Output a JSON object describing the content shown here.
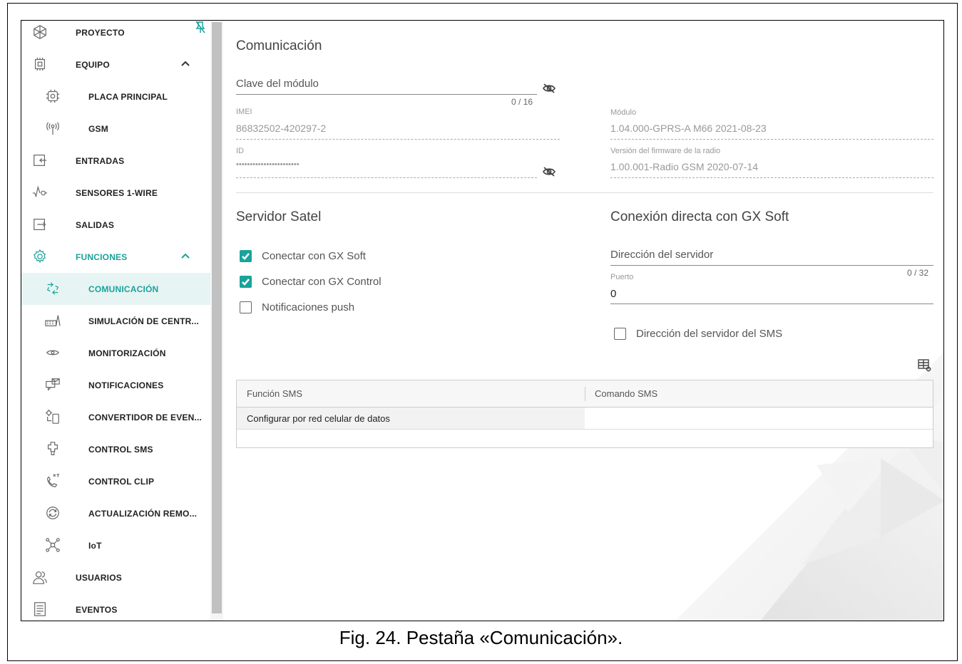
{
  "sidebar": {
    "items": [
      {
        "label": "PROYECTO",
        "icon": "project-icon",
        "type": "top"
      },
      {
        "label": "EQUIPO",
        "icon": "chip-icon",
        "type": "top",
        "expanded": true
      },
      {
        "label": "PLACA PRINCIPAL",
        "icon": "board-icon",
        "type": "sub"
      },
      {
        "label": "GSM",
        "icon": "antenna-icon",
        "type": "sub"
      },
      {
        "label": "ENTRADAS",
        "icon": "input-icon",
        "type": "top"
      },
      {
        "label": "SENSORES 1-WIRE",
        "icon": "sensor-icon",
        "type": "top"
      },
      {
        "label": "SALIDAS",
        "icon": "output-icon",
        "type": "top"
      },
      {
        "label": "FUNCIONES",
        "icon": "gear-icon",
        "type": "top",
        "expanded": true
      },
      {
        "label": "COMUNICACIÓN",
        "icon": "communication-icon",
        "type": "sub",
        "active": true
      },
      {
        "label": "SIMULACIÓN DE CENTR...",
        "icon": "keypad-icon",
        "type": "sub"
      },
      {
        "label": "MONITORIZACIÓN",
        "icon": "eye-icon",
        "type": "sub"
      },
      {
        "label": "NOTIFICACIONES",
        "icon": "message-icon",
        "type": "sub"
      },
      {
        "label": "CONVERTIDOR DE EVEN...",
        "icon": "converter-icon",
        "type": "sub"
      },
      {
        "label": "CONTROL SMS",
        "icon": "sms-icon",
        "type": "sub"
      },
      {
        "label": "CONTROL CLIP",
        "icon": "phone-icon",
        "type": "sub"
      },
      {
        "label": "ACTUALIZACIÓN REMO...",
        "icon": "refresh-icon",
        "type": "sub"
      },
      {
        "label": "IoT",
        "icon": "network-icon",
        "type": "sub"
      },
      {
        "label": "USUARIOS",
        "icon": "users-icon",
        "type": "top"
      },
      {
        "label": "EVENTOS",
        "icon": "document-icon",
        "type": "top"
      }
    ]
  },
  "main": {
    "title": "Comunicación",
    "module_key": {
      "placeholder": "Clave del módulo",
      "counter": "0 / 16"
    },
    "imei": {
      "label": "IMEI",
      "value": "86832502-420297-2"
    },
    "id": {
      "label": "ID",
      "value": "•••••••••••••••••••••••"
    },
    "modulo": {
      "label": "Módulo",
      "value": "1.04.000-GPRS-A M66 2021-08-23"
    },
    "firmware": {
      "label": "Versión del firmware de la radio",
      "value": "1.00.001-Radio GSM 2020-07-14"
    },
    "satel": {
      "title": "Servidor Satel",
      "options": [
        {
          "label": "Conectar con GX Soft",
          "checked": true
        },
        {
          "label": "Conectar con GX Control",
          "checked": true
        },
        {
          "label": "Notificaciones push",
          "checked": false
        }
      ]
    },
    "direct": {
      "title": "Conexión directa con GX Soft",
      "server_placeholder": "Dirección del servidor",
      "server_counter": "0 / 32",
      "port_label": "Puerto",
      "port_value": "0",
      "sms_server_label": "Dirección del servidor del SMS",
      "sms_server_checked": false
    },
    "sms_table": {
      "headers": [
        "Función SMS",
        "Comando SMS"
      ],
      "rows": [
        [
          "Configurar por red celular de datos",
          ""
        ]
      ]
    }
  },
  "caption": "Fig. 24. Pestaña «Comunicación».",
  "colors": {
    "accent": "#1aa39a",
    "active_bg": "#e6f4f3"
  }
}
